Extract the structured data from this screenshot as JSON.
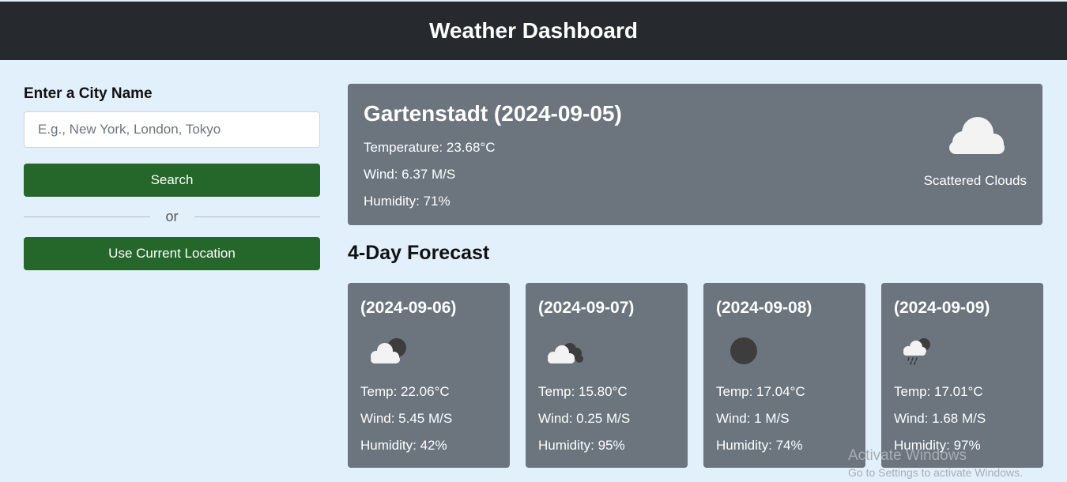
{
  "header": {
    "title": "Weather Dashboard"
  },
  "sidebar": {
    "label": "Enter a City Name",
    "placeholder": "E.g., New York, London, Tokyo",
    "search_label": "Search",
    "or_label": "or",
    "location_label": "Use Current Location"
  },
  "current": {
    "city": "Gartenstadt (2024-09-05)",
    "temperature": "Temperature: 23.68°C",
    "wind": "Wind: 6.37 M/S",
    "humidity": "Humidity: 71%",
    "description": "Scattered Clouds",
    "icon": "cloud-icon"
  },
  "forecast": {
    "title": "4-Day Forecast",
    "days": [
      {
        "date": "(2024-09-06)",
        "temp": "Temp: 22.06°C",
        "wind": "Wind: 5.45 M/S",
        "humidity": "Humidity: 42%",
        "icon": "partly-cloudy-icon"
      },
      {
        "date": "(2024-09-07)",
        "temp": "Temp: 15.80°C",
        "wind": "Wind: 0.25 M/S",
        "humidity": "Humidity: 95%",
        "icon": "broken-clouds-icon"
      },
      {
        "date": "(2024-09-08)",
        "temp": "Temp: 17.04°C",
        "wind": "Wind: 1 M/S",
        "humidity": "Humidity: 74%",
        "icon": "clear-night-icon"
      },
      {
        "date": "(2024-09-09)",
        "temp": "Temp: 17.01°C",
        "wind": "Wind: 1.68 M/S",
        "humidity": "Humidity: 97%",
        "icon": "rain-icon"
      }
    ]
  },
  "watermark": {
    "line1": "Activate Windows",
    "line2": "Go to Settings to activate Windows."
  },
  "colors": {
    "header_bg": "#262a2f",
    "page_bg": "#e2f0fc",
    "card_bg": "#6c747e",
    "button_bg": "#25662a"
  }
}
